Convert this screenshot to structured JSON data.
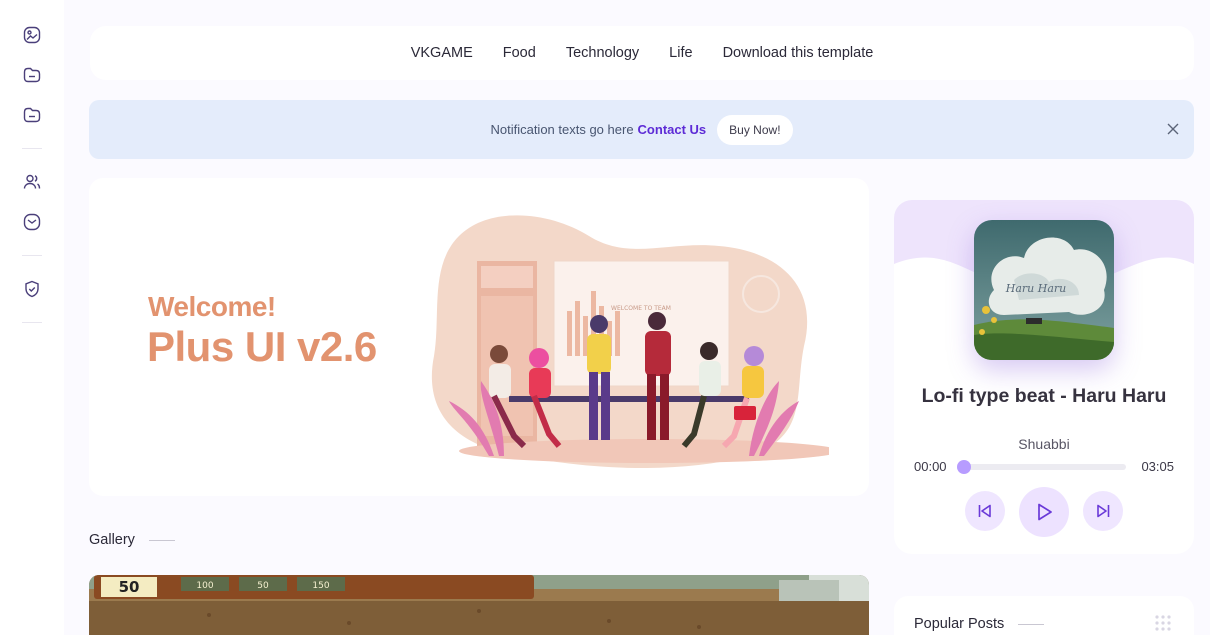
{
  "sidebar": {
    "icons": [
      "image-gallery-icon",
      "folder-icon",
      "folder-icon",
      "users-icon",
      "mail-icon",
      "shield-check-icon"
    ]
  },
  "nav": {
    "items": [
      {
        "label": "VKGAME"
      },
      {
        "label": "Food"
      },
      {
        "label": "Technology"
      },
      {
        "label": "Life"
      },
      {
        "label": "Download this template"
      }
    ]
  },
  "notification": {
    "text": "Notification texts go here",
    "link": "Contact Us",
    "button": "Buy Now!"
  },
  "hero": {
    "small": "Welcome!",
    "big": "Plus UI v2.6",
    "illustration_sign": "WELCOME TO TEAM",
    "accent_color": "#e2936f"
  },
  "gallery": {
    "title": "Gallery",
    "image_hud": {
      "sun": "50",
      "card_costs": [
        "100",
        "50",
        "150"
      ]
    }
  },
  "player": {
    "cover_text": "Haru Haru",
    "title": "Lo-fi type beat - Haru Haru",
    "artist": "Shuabbi",
    "current_time": "00:00",
    "duration": "03:05",
    "progress": 0,
    "accent_color": "#b79cff"
  },
  "popular": {
    "title": "Popular Posts"
  }
}
